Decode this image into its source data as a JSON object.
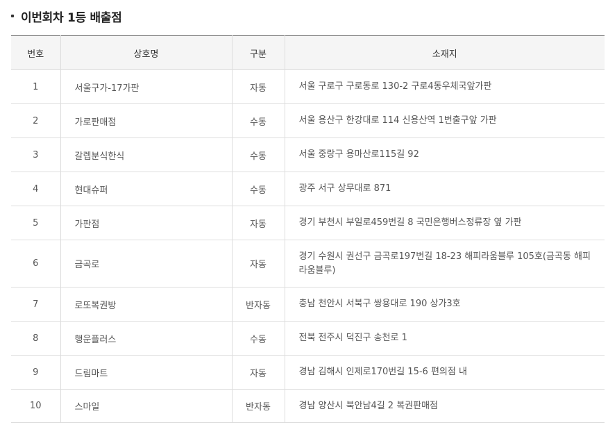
{
  "section": {
    "title": "이번회차 1등 배출점"
  },
  "table": {
    "headers": {
      "no": "번호",
      "name": "상호명",
      "type": "구분",
      "address": "소재지"
    },
    "rows": [
      {
        "no": "1",
        "name": "서울구가-17가판",
        "type": "자동",
        "address": "서울 구로구 구로동로 130-2 구로4동우체국앞가판"
      },
      {
        "no": "2",
        "name": "가로판매점",
        "type": "수동",
        "address": "서울 용산구 한강대로 114 신용산역 1번출구앞 가판"
      },
      {
        "no": "3",
        "name": "갈렙분식한식",
        "type": "수동",
        "address": "서울 중랑구 용마산로115길 92"
      },
      {
        "no": "4",
        "name": "현대슈퍼",
        "type": "수동",
        "address": "광주 서구 상무대로 871"
      },
      {
        "no": "5",
        "name": "가판점",
        "type": "자동",
        "address": "경기 부천시 부일로459번길 8 국민은행버스정류장 옆 가판"
      },
      {
        "no": "6",
        "name": "금곡로",
        "type": "자동",
        "address": "경기 수원시 권선구 금곡로197번길 18-23 해피라움블루 105호(금곡동 해피라움블루)"
      },
      {
        "no": "7",
        "name": "로또복권방",
        "type": "반자동",
        "address": "충남 천안시 서북구 쌍용대로 190 상가3호"
      },
      {
        "no": "8",
        "name": "행운플러스",
        "type": "수동",
        "address": "전북 전주시 덕진구 송천로 1"
      },
      {
        "no": "9",
        "name": "드림마트",
        "type": "자동",
        "address": "경남 김해시 인제로170번길 15-6 편의점 내"
      },
      {
        "no": "10",
        "name": "스마일",
        "type": "반자동",
        "address": "경남 양산시 북안남4길 2 복권판매점"
      }
    ]
  }
}
